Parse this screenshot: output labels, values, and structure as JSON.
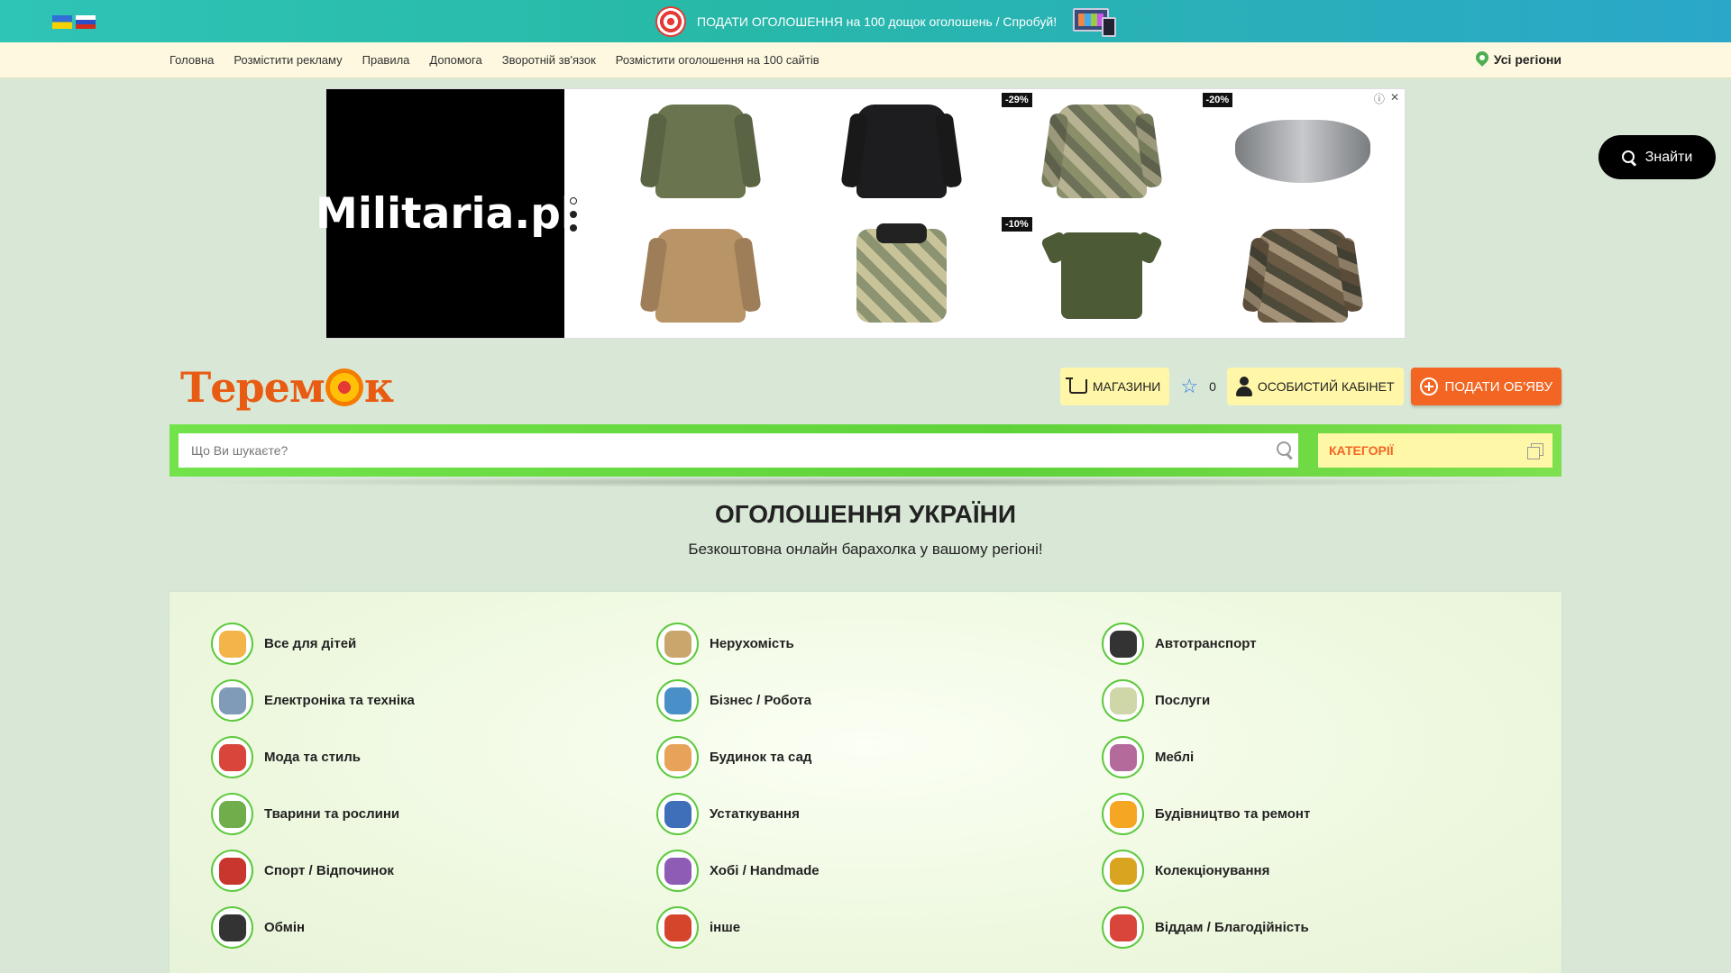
{
  "topbar": {
    "promo_text": "ПОДАТИ ОГОЛОШЕННЯ на 100 дощок оголошень / Спробуй!"
  },
  "nav": {
    "links": [
      "Головна",
      "Розмістити рекламу",
      "Правила",
      "Допомога",
      "Зворотній зв'язок",
      "Розмістити оголошення на 100 сайтів"
    ],
    "region": "Усі регіони"
  },
  "ad": {
    "brand": "Militaria.pl",
    "badges": [
      "-29%",
      "-20%",
      "-10%"
    ]
  },
  "float_search": {
    "label": "Знайти"
  },
  "header": {
    "logo_text": "Теремок",
    "shops_label": "МАГАЗИНИ",
    "favorites_count": "0",
    "cabinet_label": "ОСОБИСТИЙ КАБІНЕТ",
    "post_label": "ПОДАТИ ОБ'ЯВУ"
  },
  "search": {
    "placeholder": "Що Ви шукаєте?",
    "category_label": "КАТЕГОРІЇ"
  },
  "hero": {
    "title": "ОГОЛОШЕННЯ УКРАЇНИ",
    "subtitle": "Безкоштовна онлайн барахолка у вашому регіоні!"
  },
  "categories": [
    {
      "label": "Все для дітей",
      "color": "#f3b54a"
    },
    {
      "label": "Нерухомість",
      "color": "#c9a66b"
    },
    {
      "label": "Автотранспорт",
      "color": "#333333"
    },
    {
      "label": "Електроніка та техніка",
      "color": "#7f9bb8"
    },
    {
      "label": "Бізнес / Робота",
      "color": "#4a90c8"
    },
    {
      "label": "Послуги",
      "color": "#cfd6a8"
    },
    {
      "label": "Мода та стиль",
      "color": "#d9453b"
    },
    {
      "label": "Будинок та сад",
      "color": "#e8a35a"
    },
    {
      "label": "Меблі",
      "color": "#b56a9c"
    },
    {
      "label": "Тварини та рослини",
      "color": "#6fae4a"
    },
    {
      "label": "Устаткування",
      "color": "#3f6fb8"
    },
    {
      "label": "Будівництво та ремонт",
      "color": "#f5a623"
    },
    {
      "label": "Спорт / Відпочинок",
      "color": "#c8362e"
    },
    {
      "label": "Хобі / Handmade",
      "color": "#8e5bb5"
    },
    {
      "label": "Колекціонування",
      "color": "#d9a521"
    },
    {
      "label": "Обмін",
      "color": "#333333"
    },
    {
      "label": "інше",
      "color": "#d4452c"
    },
    {
      "label": "Віддам / Благодійність",
      "color": "#d9453b"
    }
  ]
}
